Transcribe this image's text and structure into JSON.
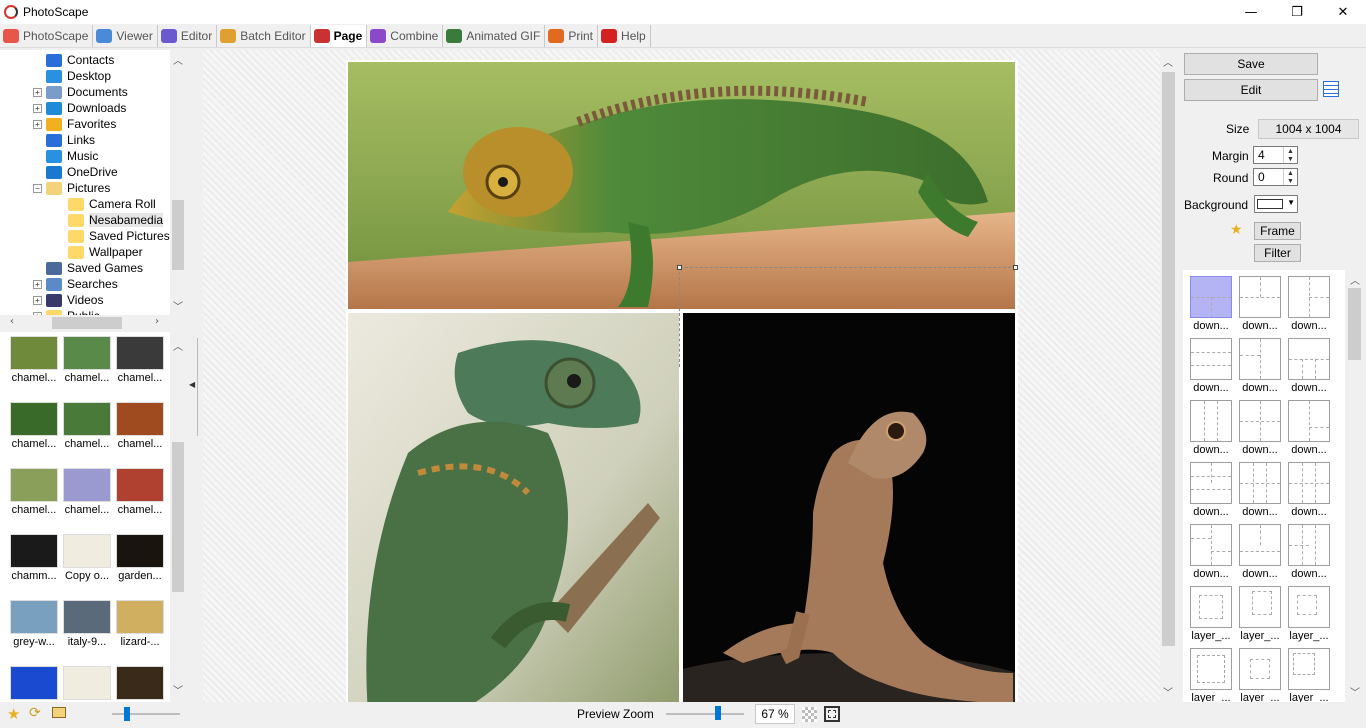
{
  "window": {
    "title": "PhotoScape",
    "minimize": "—",
    "maximize": "❐",
    "close": "✕"
  },
  "tabs": [
    {
      "label": "PhotoScape",
      "color": "#e8554a"
    },
    {
      "label": "Viewer",
      "color": "#4a8ad8"
    },
    {
      "label": "Editor",
      "color": "#6a5acd"
    },
    {
      "label": "Batch Editor",
      "color": "#e0a030"
    },
    {
      "label": "Page",
      "color": "#c83232",
      "active": true
    },
    {
      "label": "Combine",
      "color": "#8a4ac8"
    },
    {
      "label": "Animated GIF",
      "color": "#3a7a3a"
    },
    {
      "label": "Print",
      "color": "#e06a20"
    },
    {
      "label": "Help",
      "color": "#d42020"
    }
  ],
  "tree": [
    {
      "label": "Contacts",
      "icon": "contacts-icon",
      "color": "#2a6ed8"
    },
    {
      "label": "Desktop",
      "icon": "desktop-icon",
      "color": "#2a90e0"
    },
    {
      "label": "Documents",
      "icon": "documents-icon",
      "color": "#7a9cc8",
      "expandable": true
    },
    {
      "label": "Downloads",
      "icon": "downloads-icon",
      "color": "#1f8ad8",
      "expandable": true
    },
    {
      "label": "Favorites",
      "icon": "favorites-icon",
      "color": "#f0b020",
      "expandable": true
    },
    {
      "label": "Links",
      "icon": "links-icon",
      "color": "#2a6ed8"
    },
    {
      "label": "Music",
      "icon": "music-icon",
      "color": "#2a90e0"
    },
    {
      "label": "OneDrive",
      "icon": "onedrive-icon",
      "color": "#1a78d0"
    },
    {
      "label": "Pictures",
      "icon": "pictures-icon",
      "color": "#f2d27a",
      "expanded": true
    },
    {
      "label": "Camera Roll",
      "icon": "folder-icon",
      "color": "#ffd86a",
      "child": true
    },
    {
      "label": "Nesabamedia",
      "icon": "folder-icon",
      "color": "#ffd86a",
      "child": true,
      "selected": true
    },
    {
      "label": "Saved Pictures",
      "icon": "folder-icon",
      "color": "#ffd86a",
      "child": true
    },
    {
      "label": "Wallpaper",
      "icon": "folder-icon",
      "color": "#ffd86a",
      "child": true
    },
    {
      "label": "Saved Games",
      "icon": "saved-games-icon",
      "color": "#4a6a9a"
    },
    {
      "label": "Searches",
      "icon": "searches-icon",
      "color": "#5a8ac8",
      "expandable": true
    },
    {
      "label": "Videos",
      "icon": "videos-icon",
      "color": "#3a3a6a",
      "expandable": true
    },
    {
      "label": "Public",
      "icon": "folder-icon",
      "color": "#ffd86a",
      "expandable": true
    }
  ],
  "thumbnails": [
    {
      "label": "chamel...",
      "color": "#6e8a3a"
    },
    {
      "label": "chamel...",
      "color": "#5a8a4a"
    },
    {
      "label": "chamel...",
      "color": "#3a3a3a"
    },
    {
      "label": "chamel...",
      "color": "#3a6a2a"
    },
    {
      "label": "chamel...",
      "color": "#4a7a3a"
    },
    {
      "label": "chamel...",
      "color": "#a04a20"
    },
    {
      "label": "chamel...",
      "color": "#8aa05a"
    },
    {
      "label": "chamel...",
      "color": "#9a9ad0"
    },
    {
      "label": "chamel...",
      "color": "#b04030"
    },
    {
      "label": "chamm...",
      "color": "#1a1a1a"
    },
    {
      "label": "Copy o...",
      "color": "#f0ece0"
    },
    {
      "label": "garden...",
      "color": "#1a140e"
    },
    {
      "label": "grey-w...",
      "color": "#7aa0c0"
    },
    {
      "label": "italy-9...",
      "color": "#5a6a7a"
    },
    {
      "label": "lizard-...",
      "color": "#d0b060"
    },
    {
      "label": "",
      "color": "#1a4ad0"
    },
    {
      "label": "",
      "color": "#f0ece0"
    },
    {
      "label": "",
      "color": "#3a2a1a"
    }
  ],
  "right": {
    "save_label": "Save",
    "edit_label": "Edit",
    "size_label": "Size",
    "size_value": "1004 x 1004",
    "margin_label": "Margin",
    "margin_value": "4",
    "round_label": "Round",
    "round_value": "0",
    "background_label": "Background",
    "frame_label": "Frame",
    "filter_label": "Filter"
  },
  "layouts": [
    {
      "label": "down...",
      "selected": true
    },
    {
      "label": "down..."
    },
    {
      "label": "down..."
    },
    {
      "label": "down..."
    },
    {
      "label": "down..."
    },
    {
      "label": "down..."
    },
    {
      "label": "down..."
    },
    {
      "label": "down..."
    },
    {
      "label": "down..."
    },
    {
      "label": "down..."
    },
    {
      "label": "down..."
    },
    {
      "label": "down..."
    },
    {
      "label": "down..."
    },
    {
      "label": "down..."
    },
    {
      "label": "down..."
    },
    {
      "label": "layer_..."
    },
    {
      "label": "layer_..."
    },
    {
      "label": "layer_..."
    },
    {
      "label": "layer_..."
    },
    {
      "label": "layer_..."
    },
    {
      "label": "layer_..."
    }
  ],
  "status": {
    "preview_zoom_label": "Preview Zoom",
    "zoom_value": "67 %",
    "zoom_fraction": 0.67
  },
  "photos": [
    {
      "name": "chameleon-on-branch"
    },
    {
      "name": "chameleon-climbing"
    },
    {
      "name": "lizard-on-black"
    }
  ]
}
